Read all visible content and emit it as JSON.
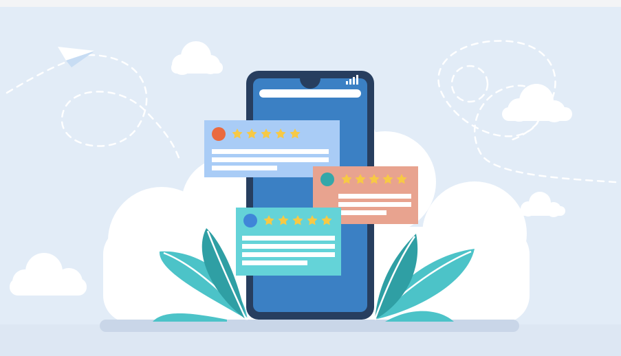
{
  "illustration": {
    "subject": "smartphone-with-review-cards",
    "colors": {
      "background": "#e2ecf7",
      "cloud": "#ffffff",
      "phone_body": "#273e5f",
      "phone_screen": "#3b80c4",
      "floor": "#c9d6e8",
      "leaf_dark": "#2f9fa4",
      "leaf_light": "#4cc3c8",
      "card_blue": "#a9ccf6",
      "card_orange": "#e8a38f",
      "card_teal": "#64d3d8",
      "dot_orange": "#ea6a3f",
      "dot_teal": "#34a7a9",
      "dot_blue": "#3f86d8",
      "star": "#f7c945"
    },
    "review_cards": [
      {
        "name": "review-card-blue",
        "rating": 5,
        "rating_max": 5
      },
      {
        "name": "review-card-orange",
        "rating": 5,
        "rating_max": 5
      },
      {
        "name": "review-card-teal",
        "rating": 5,
        "rating_max": 5
      }
    ],
    "icons": [
      "paper-plane-icon",
      "signal-bars-icon",
      "star-icon",
      "avatar-dot-icon",
      "cloud-icon",
      "leaf-icon"
    ]
  }
}
